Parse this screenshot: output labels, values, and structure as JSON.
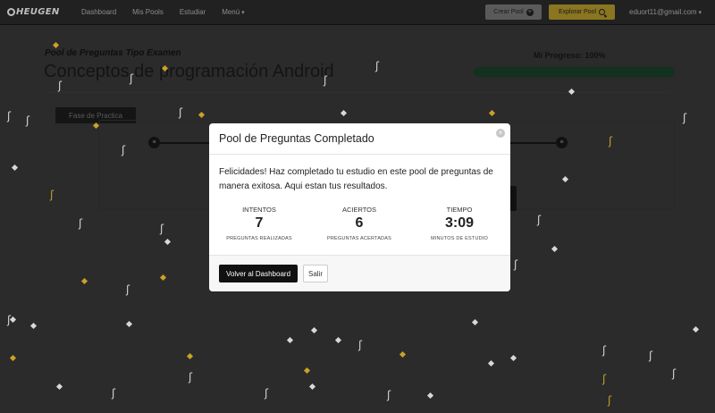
{
  "nav": {
    "brand": "HEUGEN",
    "links": [
      "Dashboard",
      "Mis Pools",
      "Estudiar",
      "Menú"
    ],
    "create_label": "Crear Pool",
    "explore_label": "Explorar Pool",
    "user_email": "eduort11@gmail.com"
  },
  "background": {
    "pool_subtitle": "Pool de Preguntas Tipo Examen",
    "pool_title": "Conceptos de programación Android",
    "progress_label": "Mi Progreso: 100%",
    "progress_fraction": 1.0,
    "phase_label": "Fase de Practica"
  },
  "modal": {
    "title": "Pool de Preguntas Completado",
    "message": "Felicidades! Haz completado tu estudio en este pool de preguntas de manera exitosa. Aqui estan tus resultados.",
    "stats": [
      {
        "label": "INTENTOS",
        "value": "7",
        "sub": "PREGUNTAS REALIZADAS"
      },
      {
        "label": "ACIERTOS",
        "value": "6",
        "sub": "PREGUNTAS ACERTADAS"
      },
      {
        "label": "TIEMPO",
        "value": "3:09",
        "sub": "MINUTOS DE ESTUDIO"
      }
    ],
    "primary_button": "Volver al Dashboard",
    "secondary_button": "Salir"
  },
  "colors": {
    "overlay_bg": "#2b2b2b",
    "navbar_bg": "#212121",
    "confetti_gold": "#c9a227",
    "confetti_white": "#d8d8d8",
    "progress_fill": "#12311f"
  }
}
